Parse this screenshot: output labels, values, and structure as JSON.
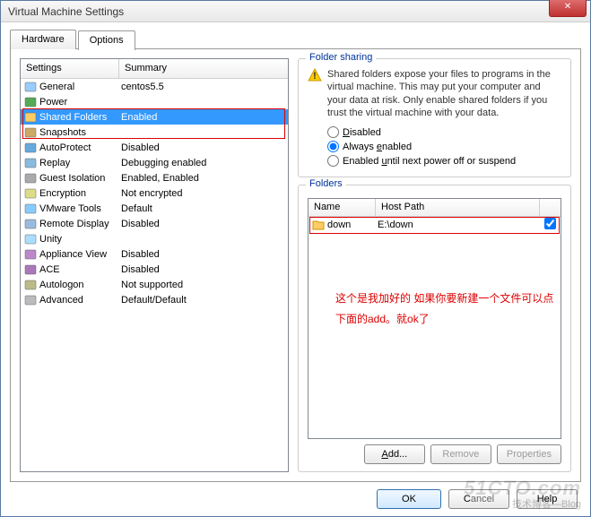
{
  "title": "Virtual Machine Settings",
  "tabs": {
    "hardware": "Hardware",
    "options": "Options"
  },
  "settings_header": {
    "col1": "Settings",
    "col2": "Summary"
  },
  "settings": [
    {
      "name": "General",
      "summary": "centos5.5",
      "icon": "monitor"
    },
    {
      "name": "Power",
      "summary": "",
      "icon": "power"
    },
    {
      "name": "Shared Folders",
      "summary": "Enabled",
      "icon": "folder",
      "selected": true
    },
    {
      "name": "Snapshots",
      "summary": "",
      "icon": "camera"
    },
    {
      "name": "AutoProtect",
      "summary": "Disabled",
      "icon": "shield"
    },
    {
      "name": "Replay",
      "summary": "Debugging enabled",
      "icon": "replay"
    },
    {
      "name": "Guest Isolation",
      "summary": "Enabled, Enabled",
      "icon": "lock"
    },
    {
      "name": "Encryption",
      "summary": "Not encrypted",
      "icon": "key"
    },
    {
      "name": "VMware Tools",
      "summary": "Default",
      "icon": "tools"
    },
    {
      "name": "Remote Display",
      "summary": "Disabled",
      "icon": "remote"
    },
    {
      "name": "Unity",
      "summary": "",
      "icon": "unity"
    },
    {
      "name": "Appliance View",
      "summary": "Disabled",
      "icon": "appliance"
    },
    {
      "name": "ACE",
      "summary": "Disabled",
      "icon": "ace"
    },
    {
      "name": "Autologon",
      "summary": "Not supported",
      "icon": "autolog"
    },
    {
      "name": "Advanced",
      "summary": "Default/Default",
      "icon": "gear"
    }
  ],
  "sharing": {
    "group_title": "Folder sharing",
    "warning": "Shared folders expose your files to programs in the virtual machine. This may put your computer and your data at risk. Only enable shared folders if you trust the virtual machine with your data.",
    "opt_disabled": "Disabled",
    "opt_always": "Always enabled",
    "opt_until": "Enabled until next power off or suspend",
    "selected": "always"
  },
  "folders": {
    "group_title": "Folders",
    "col_name": "Name",
    "col_path": "Host Path",
    "rows": [
      {
        "name": "down",
        "path": "E:\\down",
        "checked": true
      }
    ],
    "annotation": "这个是我加好的 如果你要新建一个文件可以点下面的add。就ok了",
    "btn_add": "Add...",
    "btn_remove": "Remove",
    "btn_props": "Properties"
  },
  "buttons": {
    "ok": "OK",
    "cancel": "Cancel",
    "help": "Help"
  },
  "watermark": {
    "main": "51CTO.com",
    "sub": "技术博客—Blog"
  }
}
